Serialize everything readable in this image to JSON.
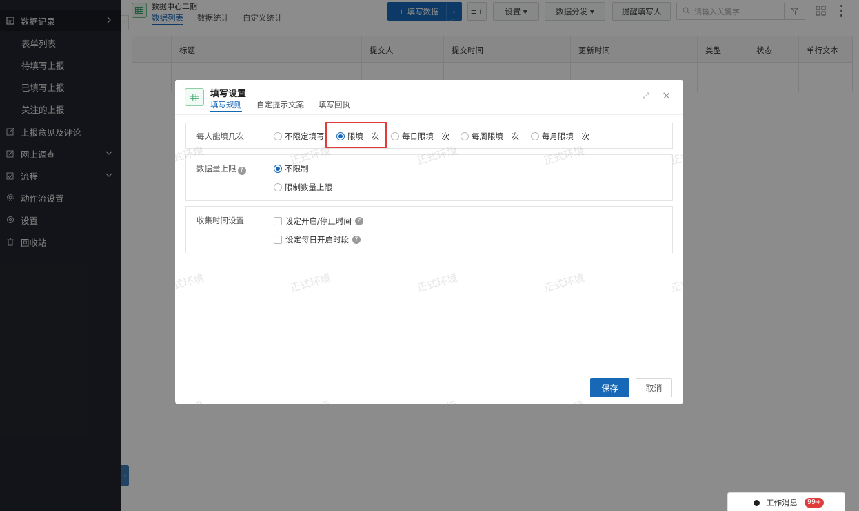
{
  "sidebar": {
    "items": [
      {
        "label": "数据记录",
        "icon": "document-icon"
      },
      {
        "label": "表单列表"
      },
      {
        "label": "待填写上报"
      },
      {
        "label": "已填写上报"
      },
      {
        "label": "关注的上报"
      },
      {
        "label": "上报意见及评论",
        "icon": "comment-edit-icon"
      },
      {
        "label": "网上调查",
        "icon": "survey-icon"
      },
      {
        "label": "流程",
        "icon": "flow-icon"
      },
      {
        "label": "动作流设置",
        "icon": "gear-icon"
      },
      {
        "label": "设置",
        "icon": "settings-icon"
      },
      {
        "label": "回收站",
        "icon": "trash-icon"
      }
    ]
  },
  "header": {
    "app_title": "数据中心二期",
    "tabs": [
      "数据列表",
      "数据统计",
      "自定义统计"
    ],
    "fill_button": "+ 填写数据",
    "settings_button": "设置 ▾",
    "distribute_button": "数据分发 ▾",
    "remind_button": "提醒填写人",
    "search_placeholder": "请输入关键字"
  },
  "table": {
    "columns": [
      "标题",
      "提交人",
      "提交时间",
      "更新时间",
      "类型",
      "状态",
      "单行文本"
    ]
  },
  "modal": {
    "title": "填写设置",
    "tabs": [
      "填写规则",
      "自定提示文案",
      "填写回执"
    ],
    "section1": {
      "label": "每人能填几次",
      "options": [
        "不限定填写",
        "限填一次",
        "每日限填一次",
        "每周限填一次",
        "每月限填一次"
      ],
      "selected": "限填一次"
    },
    "section2": {
      "label": "数据量上限",
      "options": [
        "不限制",
        "限制数量上限"
      ],
      "selected": "不限制"
    },
    "section3": {
      "label": "收集时间设置",
      "checkboxes": [
        "设定开启/停止时间",
        "设定每日开启时段"
      ]
    },
    "save_button": "保存",
    "cancel_button": "取消"
  },
  "watermark_text": "正式环境",
  "messages": {
    "label": "工作消息",
    "badge": "99+"
  },
  "colors": {
    "primary": "#1769b8",
    "sidebar_bg": "#23262e",
    "highlight": "#e03c3c"
  }
}
